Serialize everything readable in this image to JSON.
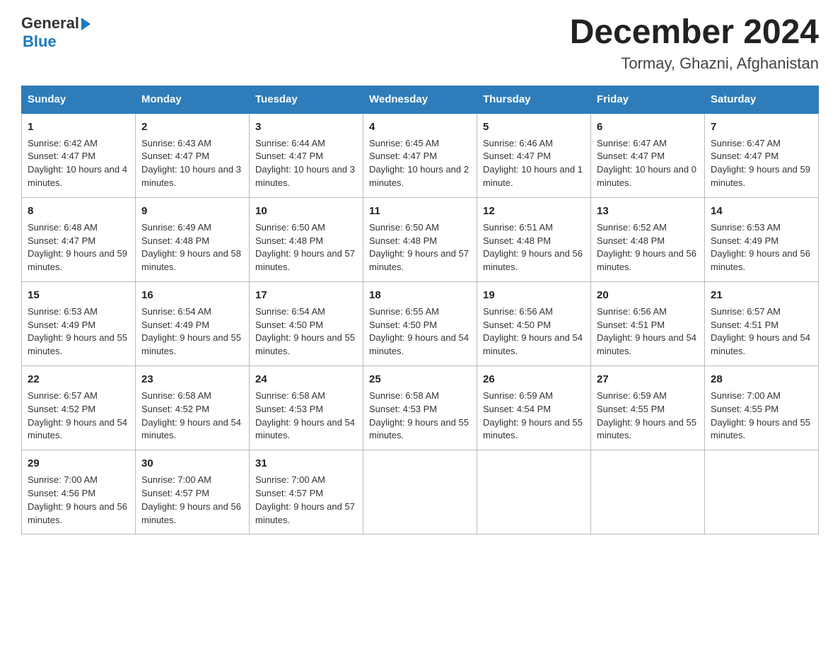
{
  "logo": {
    "text_general": "General",
    "arrow": "▶",
    "text_blue": "Blue"
  },
  "header": {
    "title": "December 2024",
    "subtitle": "Tormay, Ghazni, Afghanistan"
  },
  "days_of_week": [
    "Sunday",
    "Monday",
    "Tuesday",
    "Wednesday",
    "Thursday",
    "Friday",
    "Saturday"
  ],
  "weeks": [
    [
      {
        "day": "1",
        "sunrise": "6:42 AM",
        "sunset": "4:47 PM",
        "daylight": "10 hours and 4 minutes."
      },
      {
        "day": "2",
        "sunrise": "6:43 AM",
        "sunset": "4:47 PM",
        "daylight": "10 hours and 3 minutes."
      },
      {
        "day": "3",
        "sunrise": "6:44 AM",
        "sunset": "4:47 PM",
        "daylight": "10 hours and 3 minutes."
      },
      {
        "day": "4",
        "sunrise": "6:45 AM",
        "sunset": "4:47 PM",
        "daylight": "10 hours and 2 minutes."
      },
      {
        "day": "5",
        "sunrise": "6:46 AM",
        "sunset": "4:47 PM",
        "daylight": "10 hours and 1 minute."
      },
      {
        "day": "6",
        "sunrise": "6:47 AM",
        "sunset": "4:47 PM",
        "daylight": "10 hours and 0 minutes."
      },
      {
        "day": "7",
        "sunrise": "6:47 AM",
        "sunset": "4:47 PM",
        "daylight": "9 hours and 59 minutes."
      }
    ],
    [
      {
        "day": "8",
        "sunrise": "6:48 AM",
        "sunset": "4:47 PM",
        "daylight": "9 hours and 59 minutes."
      },
      {
        "day": "9",
        "sunrise": "6:49 AM",
        "sunset": "4:48 PM",
        "daylight": "9 hours and 58 minutes."
      },
      {
        "day": "10",
        "sunrise": "6:50 AM",
        "sunset": "4:48 PM",
        "daylight": "9 hours and 57 minutes."
      },
      {
        "day": "11",
        "sunrise": "6:50 AM",
        "sunset": "4:48 PM",
        "daylight": "9 hours and 57 minutes."
      },
      {
        "day": "12",
        "sunrise": "6:51 AM",
        "sunset": "4:48 PM",
        "daylight": "9 hours and 56 minutes."
      },
      {
        "day": "13",
        "sunrise": "6:52 AM",
        "sunset": "4:48 PM",
        "daylight": "9 hours and 56 minutes."
      },
      {
        "day": "14",
        "sunrise": "6:53 AM",
        "sunset": "4:49 PM",
        "daylight": "9 hours and 56 minutes."
      }
    ],
    [
      {
        "day": "15",
        "sunrise": "6:53 AM",
        "sunset": "4:49 PM",
        "daylight": "9 hours and 55 minutes."
      },
      {
        "day": "16",
        "sunrise": "6:54 AM",
        "sunset": "4:49 PM",
        "daylight": "9 hours and 55 minutes."
      },
      {
        "day": "17",
        "sunrise": "6:54 AM",
        "sunset": "4:50 PM",
        "daylight": "9 hours and 55 minutes."
      },
      {
        "day": "18",
        "sunrise": "6:55 AM",
        "sunset": "4:50 PM",
        "daylight": "9 hours and 54 minutes."
      },
      {
        "day": "19",
        "sunrise": "6:56 AM",
        "sunset": "4:50 PM",
        "daylight": "9 hours and 54 minutes."
      },
      {
        "day": "20",
        "sunrise": "6:56 AM",
        "sunset": "4:51 PM",
        "daylight": "9 hours and 54 minutes."
      },
      {
        "day": "21",
        "sunrise": "6:57 AM",
        "sunset": "4:51 PM",
        "daylight": "9 hours and 54 minutes."
      }
    ],
    [
      {
        "day": "22",
        "sunrise": "6:57 AM",
        "sunset": "4:52 PM",
        "daylight": "9 hours and 54 minutes."
      },
      {
        "day": "23",
        "sunrise": "6:58 AM",
        "sunset": "4:52 PM",
        "daylight": "9 hours and 54 minutes."
      },
      {
        "day": "24",
        "sunrise": "6:58 AM",
        "sunset": "4:53 PM",
        "daylight": "9 hours and 54 minutes."
      },
      {
        "day": "25",
        "sunrise": "6:58 AM",
        "sunset": "4:53 PM",
        "daylight": "9 hours and 55 minutes."
      },
      {
        "day": "26",
        "sunrise": "6:59 AM",
        "sunset": "4:54 PM",
        "daylight": "9 hours and 55 minutes."
      },
      {
        "day": "27",
        "sunrise": "6:59 AM",
        "sunset": "4:55 PM",
        "daylight": "9 hours and 55 minutes."
      },
      {
        "day": "28",
        "sunrise": "7:00 AM",
        "sunset": "4:55 PM",
        "daylight": "9 hours and 55 minutes."
      }
    ],
    [
      {
        "day": "29",
        "sunrise": "7:00 AM",
        "sunset": "4:56 PM",
        "daylight": "9 hours and 56 minutes."
      },
      {
        "day": "30",
        "sunrise": "7:00 AM",
        "sunset": "4:57 PM",
        "daylight": "9 hours and 56 minutes."
      },
      {
        "day": "31",
        "sunrise": "7:00 AM",
        "sunset": "4:57 PM",
        "daylight": "9 hours and 57 minutes."
      },
      null,
      null,
      null,
      null
    ]
  ],
  "labels": {
    "sunrise": "Sunrise:",
    "sunset": "Sunset:",
    "daylight": "Daylight:"
  }
}
